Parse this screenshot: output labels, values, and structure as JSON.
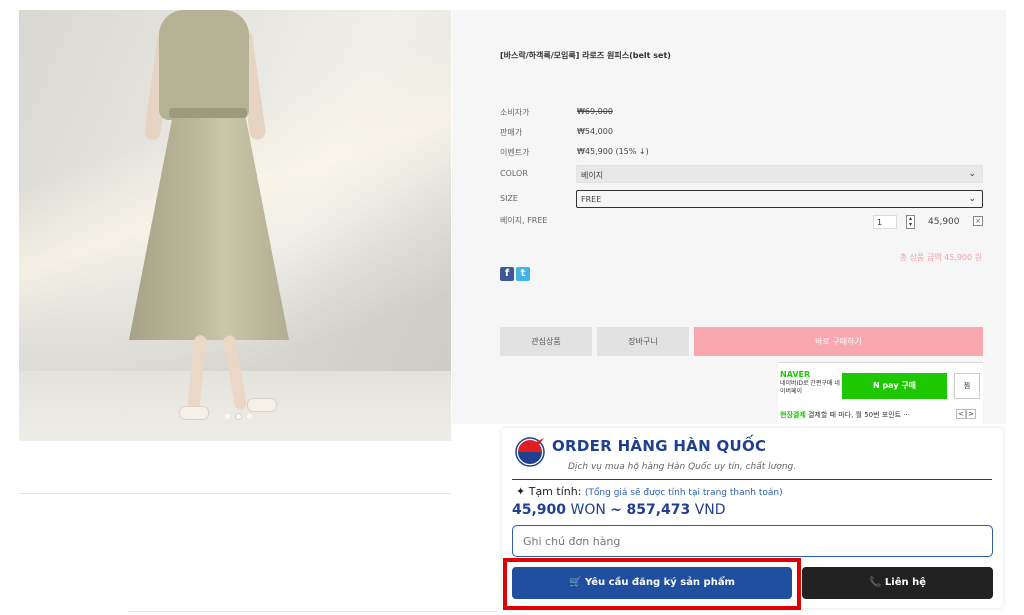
{
  "product": {
    "title": "[바스락/하객룩/모임룩] 라로즈 원피스(belt set)",
    "rows": [
      {
        "label": "소비자가",
        "value": "₩69,000"
      },
      {
        "label": "판매가",
        "value": "₩54,000"
      },
      {
        "label": "이벤트가",
        "value": "₩45,900 (15% ↓)"
      }
    ],
    "color": {
      "label": "COLOR",
      "value": "베이지"
    },
    "size": {
      "label": "SIZE",
      "value": "FREE"
    },
    "selection": {
      "label": "베이지, FREE",
      "qty": "1",
      "price": "45,900",
      "remove": "×"
    },
    "total": "총 상품 금액 45,900 원"
  },
  "buttons": {
    "wishlist": "관심상품",
    "cart": "장바구니",
    "buy_now": "바로 구매하기"
  },
  "naver": {
    "logo": "NAVER",
    "desc": "네이버ID로 간편구매 네이버페이",
    "npay": "N pay 구매",
    "jjim": "찜",
    "promo_green": "현장결제",
    "promo_text": " 결제할 때 마다, 월 50번 포인트 ···",
    "prev": "<",
    "next": ">"
  },
  "order": {
    "title": "ORDER HÀNG HÀN QUỐC",
    "subtitle": "Dịch vụ mua hộ hàng Hàn Quốc uy tín, chất lượng.",
    "estimate_label": "Tạm tính:",
    "estimate_note": "(Tổng giá sẽ được tính tại trang thanh toán)",
    "price_won": "45,900",
    "unit_won": "WON",
    "sep": "~",
    "price_vnd": "857,473",
    "unit_vnd": "VND",
    "note_placeholder": "Ghi chú đơn hàng",
    "request_label": "Yêu cầu đăng ký sản phẩm",
    "contact_label": "Liên hệ"
  },
  "colors": {
    "buy_pink": "#f7a7ad",
    "naver_green": "#1ec800",
    "brand_blue": "#1f4f9e",
    "highlight_red": "#e00000"
  },
  "icons": {
    "cart": "cart-icon",
    "phone": "phone-icon",
    "chevron": "chevron-down-icon",
    "facebook": "facebook-icon",
    "twitter": "twitter-icon",
    "sparkle": "sparkle-icon"
  }
}
